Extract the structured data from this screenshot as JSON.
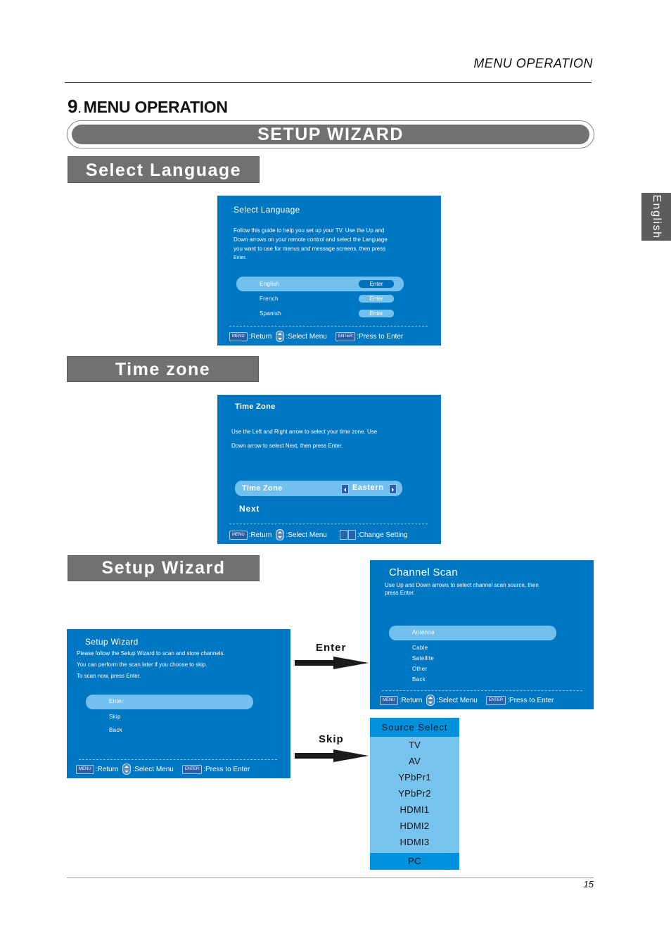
{
  "page": {
    "running_head": "MENU OPERATION",
    "section_number": "9",
    "section_dot": ".",
    "section_title": "MENU OPERATION",
    "banner": "SETUP WIZARD",
    "side_tab": "English",
    "page_number": "15"
  },
  "subsections": {
    "select_language": "Select Language",
    "time_zone": "Time zone",
    "setup_wizard": "Setup Wizard"
  },
  "footer_keys": {
    "menu_key": "MENU",
    "return_label": ":Return",
    "select_menu_label": ":Select Menu",
    "enter_key": "ENTER",
    "press_enter_label": ":Press to Enter",
    "change_setting_label": ":Change Setting"
  },
  "select_language_screen": {
    "title": "Select  Language",
    "description_lines": [
      "Follow this guide to help you set up your TV. Use the Up and",
      "Down arrows on your remote control and select the Language",
      "you want to use for menus and message screens, then press",
      "Enter."
    ],
    "languages": [
      {
        "name": "English",
        "button": "Enter",
        "selected": true
      },
      {
        "name": "French",
        "button": "Enter",
        "selected": false
      },
      {
        "name": "Spanish",
        "button": "Enter",
        "selected": false
      }
    ]
  },
  "time_zone_screen": {
    "title": "Time Zone",
    "description_lines": [
      "Use the Left and Right arrow to select your time zone. Use",
      "Down arrow to select Next, then press Enter."
    ],
    "setting_label": "Time Zone",
    "setting_value": "Eastern",
    "next_label": "Next"
  },
  "setup_wizard_screen": {
    "title": "Setup Wizard",
    "description_lines": [
      "Please follow the Setup Wizard to scan and store channels.",
      "You can perform the scan later if you choose to skip.",
      "To scan now, press Enter."
    ],
    "options": [
      "Enter",
      "Skip",
      "Back"
    ],
    "selected_index": 0
  },
  "arrows": {
    "enter_label": "Enter",
    "skip_label": "Skip"
  },
  "channel_scan_screen": {
    "title": "Channel Scan",
    "description_lines": [
      "Use Up and Down arrows to select channel scan source, then",
      "press Enter."
    ],
    "options": [
      "Antenna",
      "Cable",
      "Satellite",
      "Other",
      "Back"
    ],
    "selected_index": 0
  },
  "source_select": {
    "title": "Source  Select",
    "options": [
      "TV",
      "AV",
      "YPbPr1",
      "YPbPr2",
      "HDMI1",
      "HDMI2",
      "HDMI3"
    ],
    "selected": "PC"
  },
  "colors": {
    "tv_background": "#0077c2",
    "highlight": "#72c0ee",
    "banner_gray": "#727070"
  }
}
